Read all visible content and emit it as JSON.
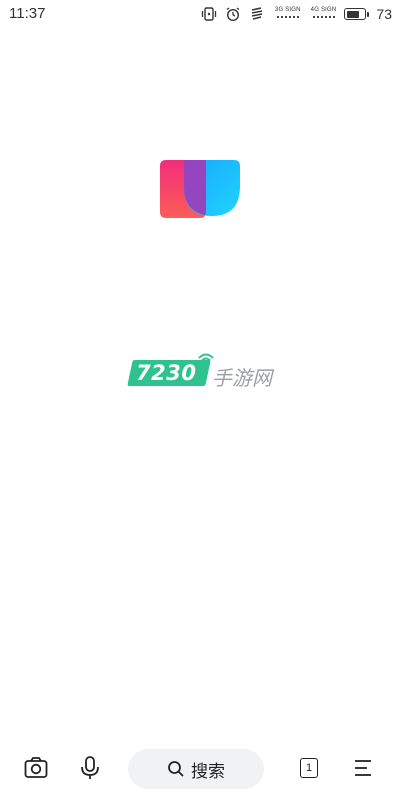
{
  "status_bar": {
    "time": "11:37",
    "icons": [
      "vibrate-icon",
      "alarm-icon",
      "data-transfer-icon"
    ],
    "signal_1_label": "3G SIGN",
    "signal_2_label": "4G SIGN",
    "battery_level": 73,
    "battery_text": "73"
  },
  "splash": {
    "logo_icon": "app-logo-icon",
    "colors": {
      "pink": "#f0316c",
      "red": "#fb5a5f",
      "blue": "#1fa8ff",
      "overlap": "#9b3fb8"
    }
  },
  "watermark": {
    "number": "7230",
    "text": "手游网",
    "accent": "#2ec28e"
  },
  "toolbar": {
    "camera_icon": "camera-icon",
    "mic_icon": "microphone-icon",
    "search_label": "搜索",
    "tab_count": "1",
    "menu_icon": "menu-icon"
  }
}
